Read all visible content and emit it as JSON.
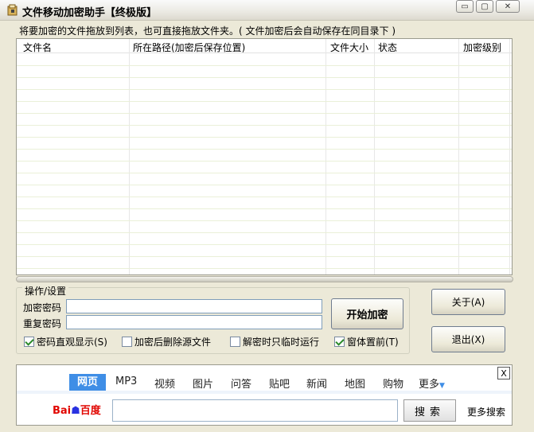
{
  "window": {
    "title": "文件移动加密助手【终极版】",
    "controls": {
      "minimize": "▭",
      "maximize": "▢",
      "close": "✕"
    }
  },
  "hint": "将要加密的文件拖放到列表，也可直接拖放文件夹。( 文件加密后会自动保存在同目录下 )",
  "list": {
    "columns": [
      "文件名",
      "所在路径(加密后保存位置)",
      "文件大小",
      "状态",
      "加密级别"
    ]
  },
  "settings": {
    "group_title": "操作/设置",
    "password_label": "加密密码",
    "password_value": "",
    "confirm_label": "重复密码",
    "confirm_value": "",
    "start_button": "开始加密",
    "checkboxes": [
      {
        "label": "密码直观显示(S)",
        "checked": true
      },
      {
        "label": "加密后删除源文件",
        "checked": false
      },
      {
        "label": "解密时只临时运行",
        "checked": false
      },
      {
        "label": "窗体置前(T)",
        "checked": true
      }
    ]
  },
  "side_buttons": {
    "about": "关于(A)",
    "exit": "退出(X)"
  },
  "baidu": {
    "tabs": [
      "网页",
      "MP3",
      "视频",
      "图片",
      "问答",
      "贴吧",
      "新闻",
      "地图",
      "购物",
      "更多"
    ],
    "active_tab": "网页",
    "logo": "Bai百度",
    "search_value": "",
    "search_button": "搜索",
    "more_search": "更多搜索",
    "close": "X"
  },
  "colors": {
    "window_bg": "#ece9d8",
    "baidu_tab_active": "#3f8ee6",
    "baidu_red": "#e10601",
    "baidu_blue": "#2932e1"
  }
}
